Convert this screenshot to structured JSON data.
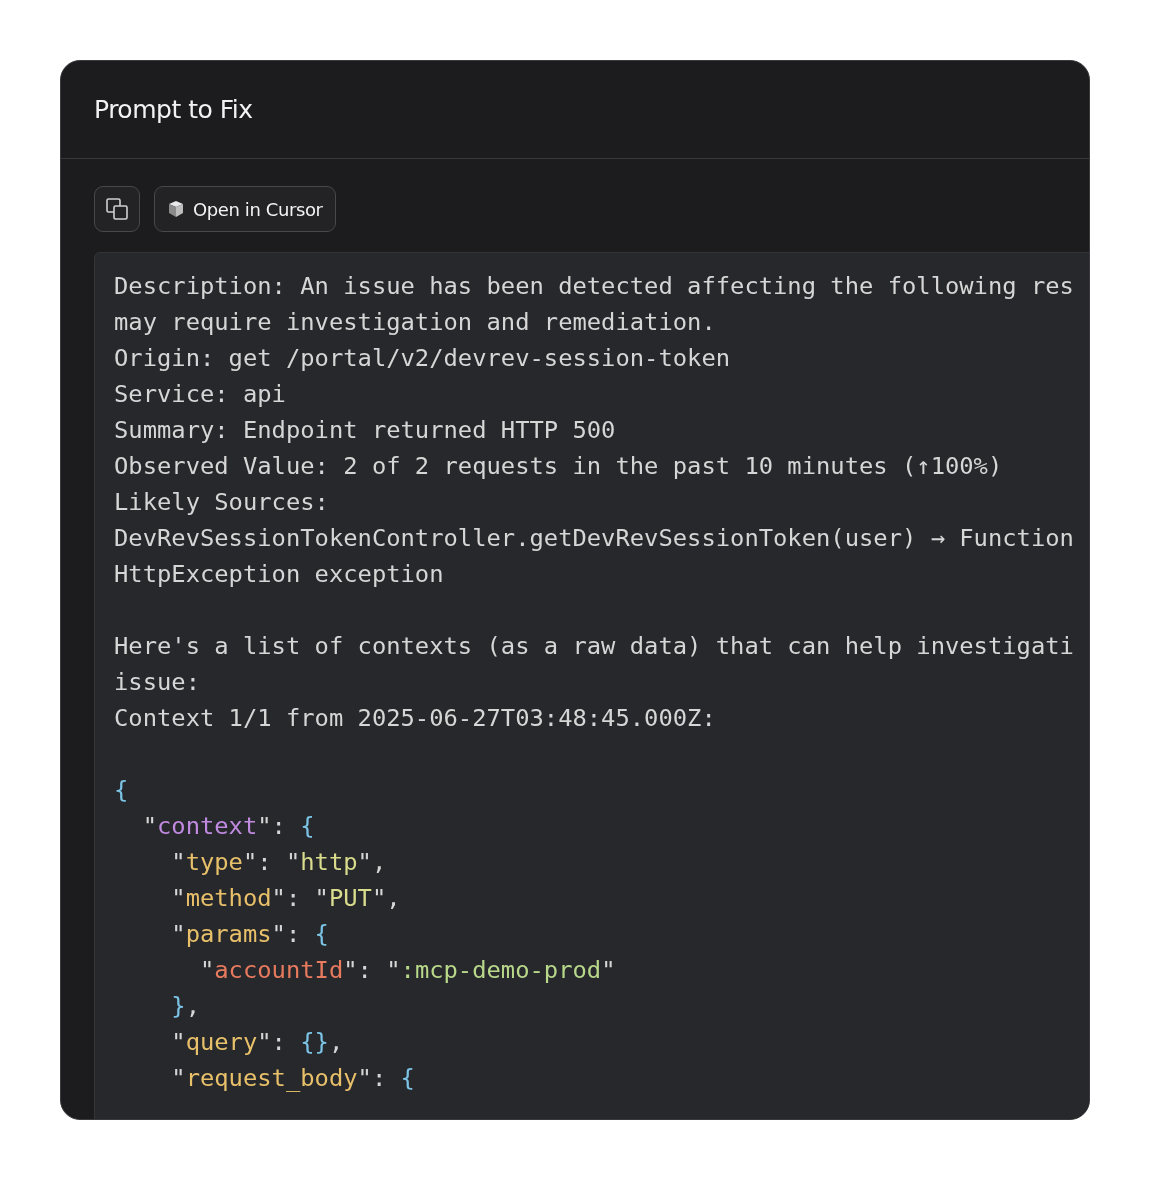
{
  "dialog": {
    "title": "Prompt to Fix"
  },
  "toolbar": {
    "open_button": {
      "label": "Open in Cursor"
    }
  },
  "code": {
    "lines": [
      {
        "kind": "text",
        "segments": [
          {
            "text": "Description: An issue has been detected affecting the following res"
          }
        ]
      },
      {
        "kind": "text",
        "segments": [
          {
            "text": "may require investigation and remediation."
          }
        ]
      },
      {
        "kind": "text",
        "segments": [
          {
            "text": "Origin: get /portal/v2/devrev-session-token"
          }
        ]
      },
      {
        "kind": "text",
        "segments": [
          {
            "text": "Service: api"
          }
        ]
      },
      {
        "kind": "text",
        "segments": [
          {
            "text": "Summary: Endpoint returned HTTP 500"
          }
        ]
      },
      {
        "kind": "text",
        "segments": [
          {
            "text": "Observed Value: 2 of 2 requests in the past 10 minutes (↑100%)"
          }
        ]
      },
      {
        "kind": "text",
        "segments": [
          {
            "text": "Likely Sources:"
          }
        ]
      },
      {
        "kind": "text",
        "segments": [
          {
            "text": "DevRevSessionTokenController.getDevRevSessionToken(user) → Function"
          }
        ]
      },
      {
        "kind": "text",
        "segments": [
          {
            "text": "HttpException exception"
          }
        ]
      },
      {
        "kind": "blank"
      },
      {
        "kind": "text",
        "segments": [
          {
            "text": "Here's a list of contexts (as a raw data) that can help investigati"
          }
        ]
      },
      {
        "kind": "text",
        "segments": [
          {
            "text": "issue:"
          }
        ]
      },
      {
        "kind": "text",
        "segments": [
          {
            "text": "Context 1/1 from 2025-06-27T03:48:45.000Z:"
          }
        ]
      },
      {
        "kind": "blank"
      },
      {
        "kind": "json",
        "segments": [
          {
            "text": "{",
            "color": "#7cc4e6"
          }
        ]
      },
      {
        "kind": "json",
        "segments": [
          {
            "text": "  \""
          },
          {
            "text": "context",
            "color": "#c08ae0"
          },
          {
            "text": "\": "
          },
          {
            "text": "{",
            "color": "#7cc4e6"
          }
        ]
      },
      {
        "kind": "json",
        "segments": [
          {
            "text": "    \""
          },
          {
            "text": "type",
            "color": "#e8c06a"
          },
          {
            "text": "\": \""
          },
          {
            "text": "http",
            "color": "#d8dc8c"
          },
          {
            "text": "\","
          }
        ]
      },
      {
        "kind": "json",
        "segments": [
          {
            "text": "    \""
          },
          {
            "text": "method",
            "color": "#e8c06a"
          },
          {
            "text": "\": \""
          },
          {
            "text": "PUT",
            "color": "#d8dc8c"
          },
          {
            "text": "\","
          }
        ]
      },
      {
        "kind": "json",
        "segments": [
          {
            "text": "    \""
          },
          {
            "text": "params",
            "color": "#e8c06a"
          },
          {
            "text": "\": "
          },
          {
            "text": "{",
            "color": "#7cc4e6"
          }
        ]
      },
      {
        "kind": "json",
        "segments": [
          {
            "text": "      \""
          },
          {
            "text": "accountId",
            "color": "#e87a5e"
          },
          {
            "text": "\": \""
          },
          {
            "text": ":mcp-demo-prod",
            "color": "#b8d88a"
          },
          {
            "text": "\""
          }
        ]
      },
      {
        "kind": "json",
        "segments": [
          {
            "text": "    }",
            "color": "#7cc4e6"
          },
          {
            "text": ","
          }
        ]
      },
      {
        "kind": "json",
        "segments": [
          {
            "text": "    \""
          },
          {
            "text": "query",
            "color": "#e8c06a"
          },
          {
            "text": "\": "
          },
          {
            "text": "{}",
            "color": "#7cc4e6"
          },
          {
            "text": ","
          }
        ]
      },
      {
        "kind": "json",
        "segments": [
          {
            "text": "    \""
          },
          {
            "text": "request_body",
            "color": "#e8c06a"
          },
          {
            "text": "\": "
          },
          {
            "text": "{",
            "color": "#7cc4e6"
          }
        ]
      }
    ]
  }
}
